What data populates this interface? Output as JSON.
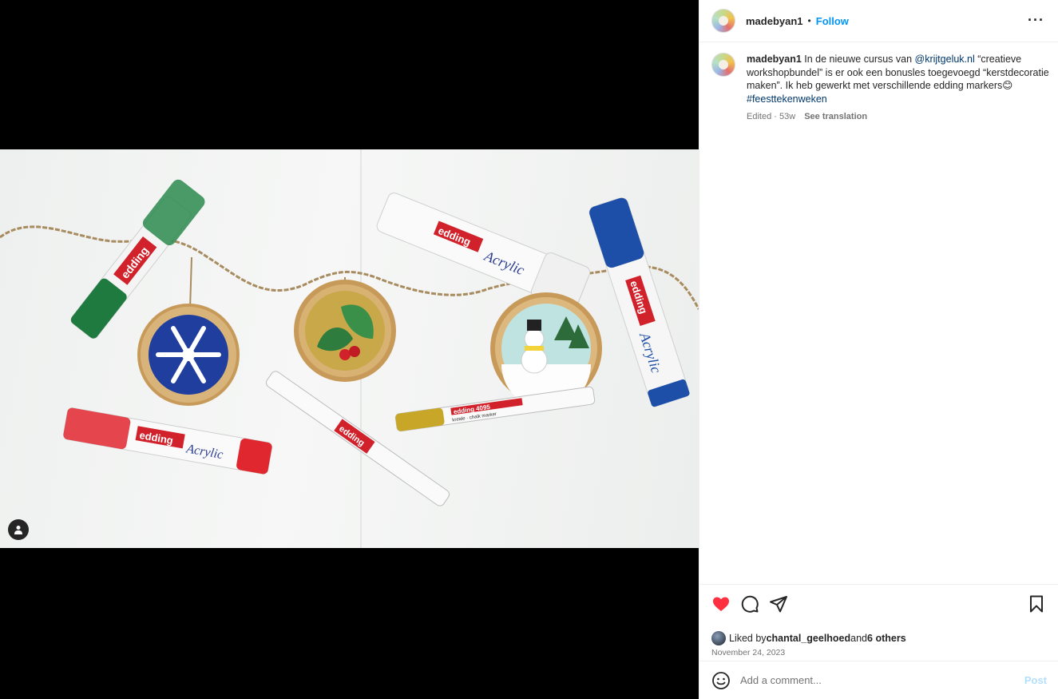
{
  "post": {
    "username": "madebyan1",
    "follow_label": "Follow",
    "separator": "•",
    "more_label": "···"
  },
  "caption": {
    "username": "madebyan1",
    "text_before_mention": " In de nieuwe cursus van ",
    "mention": "@krijtgeluk.nl",
    "text_after_mention": " “creatieve workshopbundel” is er ook een bonusles toegevoegd “kerstdecoratie maken”. Ik heb gewerkt met verschillende edding markers",
    "emoji": "😊",
    "hashtag": "#feesttekenweken",
    "edited": "Edited · 53w",
    "see_translation": "See translation"
  },
  "photo": {
    "brand_text": "edding",
    "marker_text": "Acrylic",
    "chalk_text": "edding 4095",
    "chalk_sub": "kreide · chalk marker"
  },
  "actions": {
    "liked_by_prefix": "Liked by ",
    "liked_by_user": "chantal_geelhoed",
    "liked_by_and": " and ",
    "liked_by_others": "6 others",
    "date": "November 24, 2023",
    "liked": true
  },
  "comment": {
    "placeholder": "Add a comment...",
    "post_label": "Post"
  },
  "colors": {
    "follow": "#0095f6",
    "heart": "#ff3040",
    "link": "#00376b",
    "post_disabled": "#b2dffc"
  }
}
